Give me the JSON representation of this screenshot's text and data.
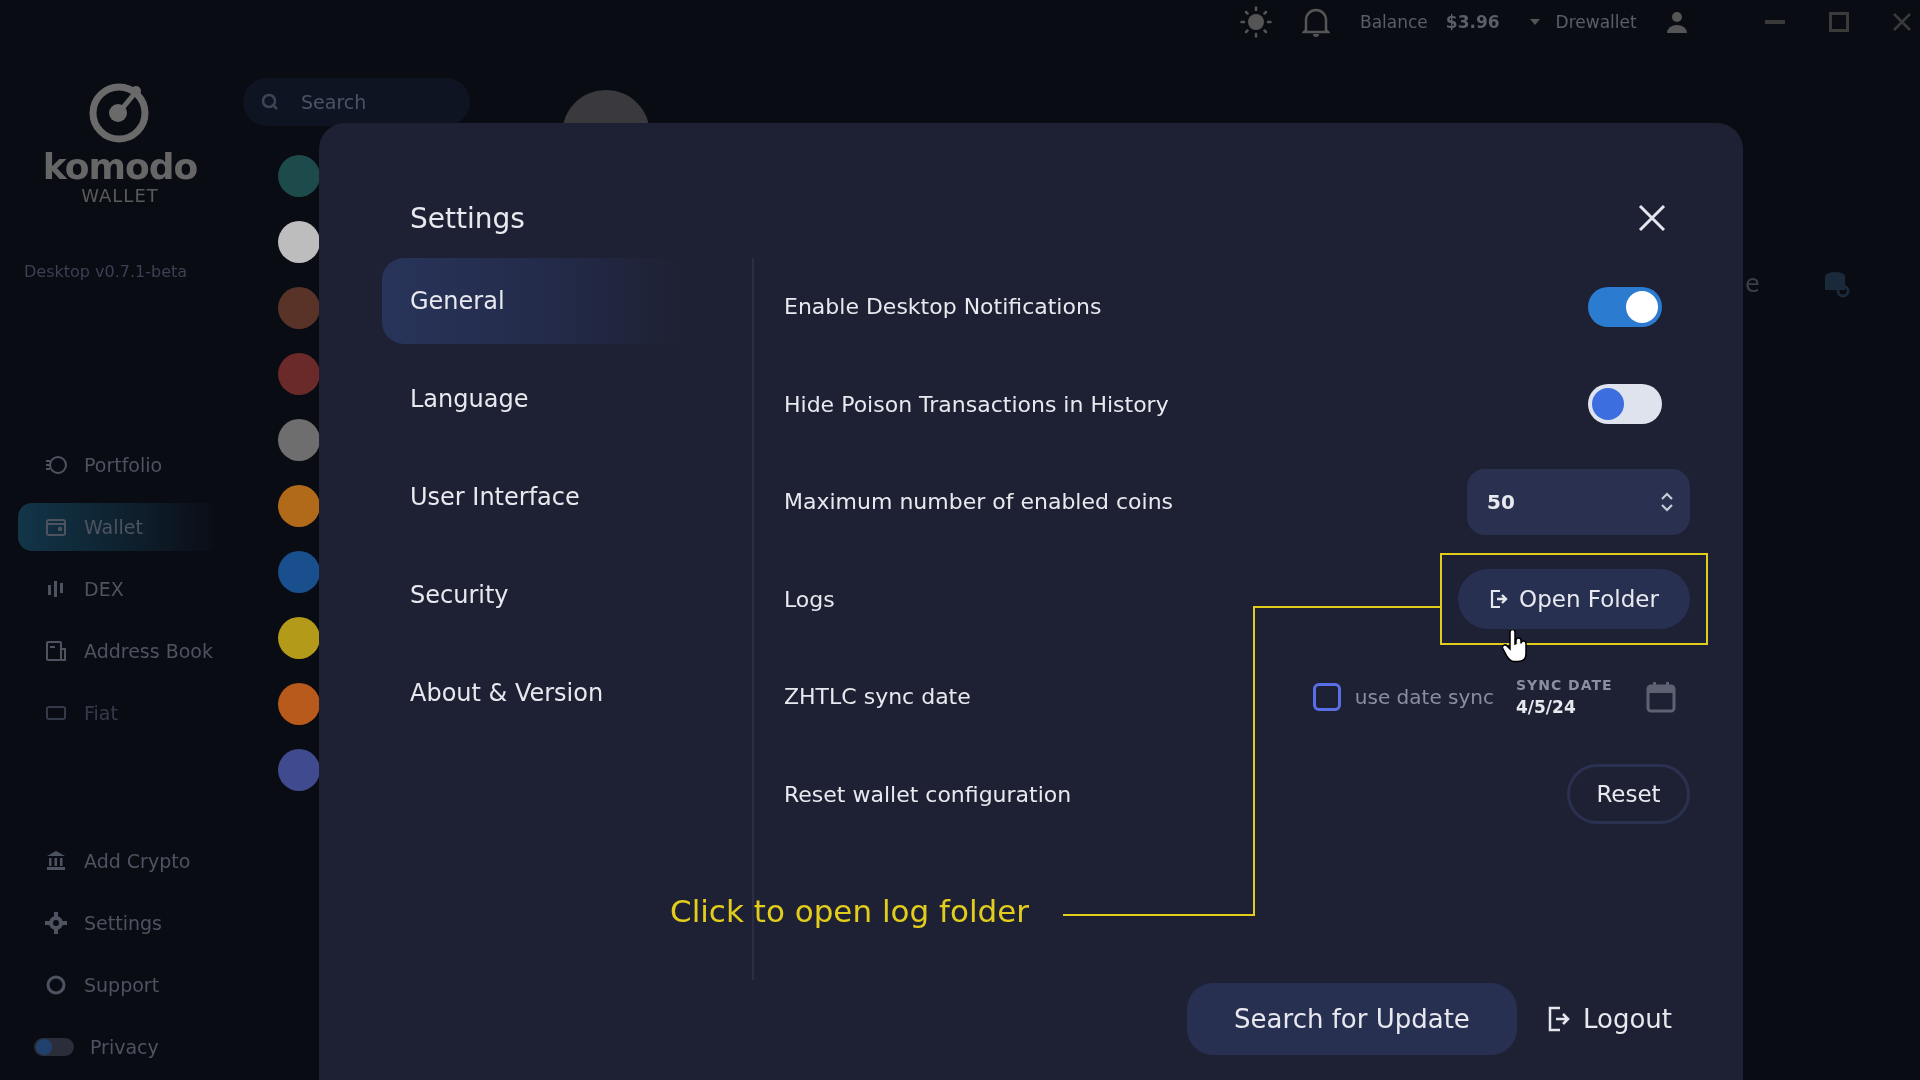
{
  "topbar": {
    "balance_label": "Balance",
    "balance": "$3.96",
    "account": "Drewallet"
  },
  "sidebar": {
    "logo_wordmark": "komodo",
    "logo_subtitle": "WALLET",
    "version": "Desktop v0.7.1-beta",
    "items": [
      {
        "label": "Portfolio",
        "kind": "portfolio",
        "selected": false,
        "disabled": false
      },
      {
        "label": "Wallet",
        "kind": "wallet",
        "selected": true,
        "disabled": false
      },
      {
        "label": "DEX",
        "kind": "dex",
        "selected": false,
        "disabled": false
      },
      {
        "label": "Address Book",
        "kind": "book",
        "selected": false,
        "disabled": false
      },
      {
        "label": "Fiat",
        "kind": "fiat",
        "selected": false,
        "disabled": true
      }
    ],
    "bottom_items": [
      {
        "label": "Add Crypto",
        "kind": "bank"
      },
      {
        "label": "Settings",
        "kind": "gear"
      },
      {
        "label": "Support",
        "kind": "support"
      }
    ],
    "privacy": {
      "label": "Privacy",
      "on": false
    }
  },
  "search": {
    "placeholder": "Search"
  },
  "coins": [
    {
      "color": "#1d4a4a"
    },
    {
      "color": "#bdbdbd"
    },
    {
      "color": "#5a3328"
    },
    {
      "color": "#6a2a2a"
    },
    {
      "color": "#6e6e6e"
    },
    {
      "color": "#b06a1a"
    },
    {
      "color": "#184f8c"
    },
    {
      "color": "#b39a18"
    },
    {
      "color": "#b85a1c"
    },
    {
      "color": "#3f4b8e"
    }
  ],
  "page_fragment": "e",
  "settings": {
    "title": "Settings",
    "nav": [
      {
        "label": "General",
        "selected": true
      },
      {
        "label": "Language",
        "selected": false
      },
      {
        "label": "User Interface",
        "selected": false
      },
      {
        "label": "Security",
        "selected": false
      },
      {
        "label": "About & Version",
        "selected": false
      }
    ],
    "rows": [
      {
        "kind": "toggle",
        "label": "Enable Desktop Notifications",
        "on": true
      },
      {
        "kind": "toggle",
        "label": "Hide Poison Transactions in History",
        "on": false
      },
      {
        "kind": "select",
        "label": "Maximum number of enabled coins",
        "value": "50"
      },
      {
        "kind": "button",
        "label": "Logs",
        "button": "Open Folder",
        "highlighted": true
      },
      {
        "kind": "date",
        "label": "ZHTLC sync date",
        "checkbox_label": "use date sync",
        "checked": false,
        "date_label": "SYNC DATE",
        "date": "4/5/24"
      },
      {
        "kind": "outline_button",
        "label": "Reset wallet configuration",
        "button": "Reset",
        "highlighted": false
      }
    ],
    "footer": {
      "update_button": "Search for Update",
      "logout_button": "Logout"
    }
  },
  "annotation": {
    "text": "Click to open log folder"
  }
}
